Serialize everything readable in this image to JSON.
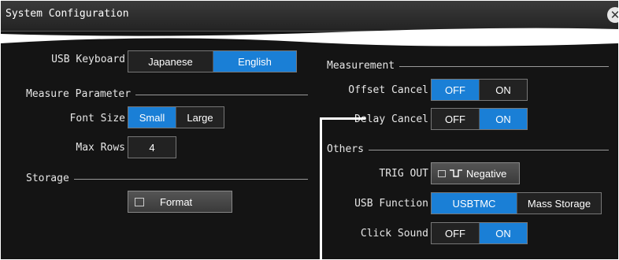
{
  "window": {
    "title": "System Configuration"
  },
  "usb_keyboard": {
    "label": "USB Keyboard",
    "options": [
      "Japanese",
      "English"
    ],
    "selected": "English"
  },
  "measure_parameter": {
    "heading": "Measure Parameter",
    "font_size": {
      "label": "Font Size",
      "options": [
        "Small",
        "Large"
      ],
      "selected": "Small"
    },
    "max_rows": {
      "label": "Max Rows",
      "value": "4"
    }
  },
  "storage": {
    "heading": "Storage",
    "format_button": "Format"
  },
  "measurement": {
    "heading": "Measurement",
    "offset_cancel": {
      "label": "Offset Cancel",
      "options": [
        "OFF",
        "ON"
      ],
      "selected": "OFF"
    },
    "delay_cancel": {
      "label": "Delay Cancel",
      "options": [
        "OFF",
        "ON"
      ],
      "selected": "ON"
    }
  },
  "others": {
    "heading": "Others",
    "trig_out": {
      "label": "TRIG OUT",
      "value": "Negative"
    },
    "usb_function": {
      "label": "USB Function",
      "options": [
        "USBTMC",
        "Mass Storage"
      ],
      "selected": "USBTMC"
    },
    "click_sound": {
      "label": "Click Sound",
      "options": [
        "OFF",
        "ON"
      ],
      "selected": "ON"
    }
  },
  "colors": {
    "accent": "#1a7fd6",
    "background": "#141414",
    "text": "#e6e6e6"
  },
  "icons": [
    "close-icon",
    "format-icon",
    "trig-out-icon"
  ]
}
